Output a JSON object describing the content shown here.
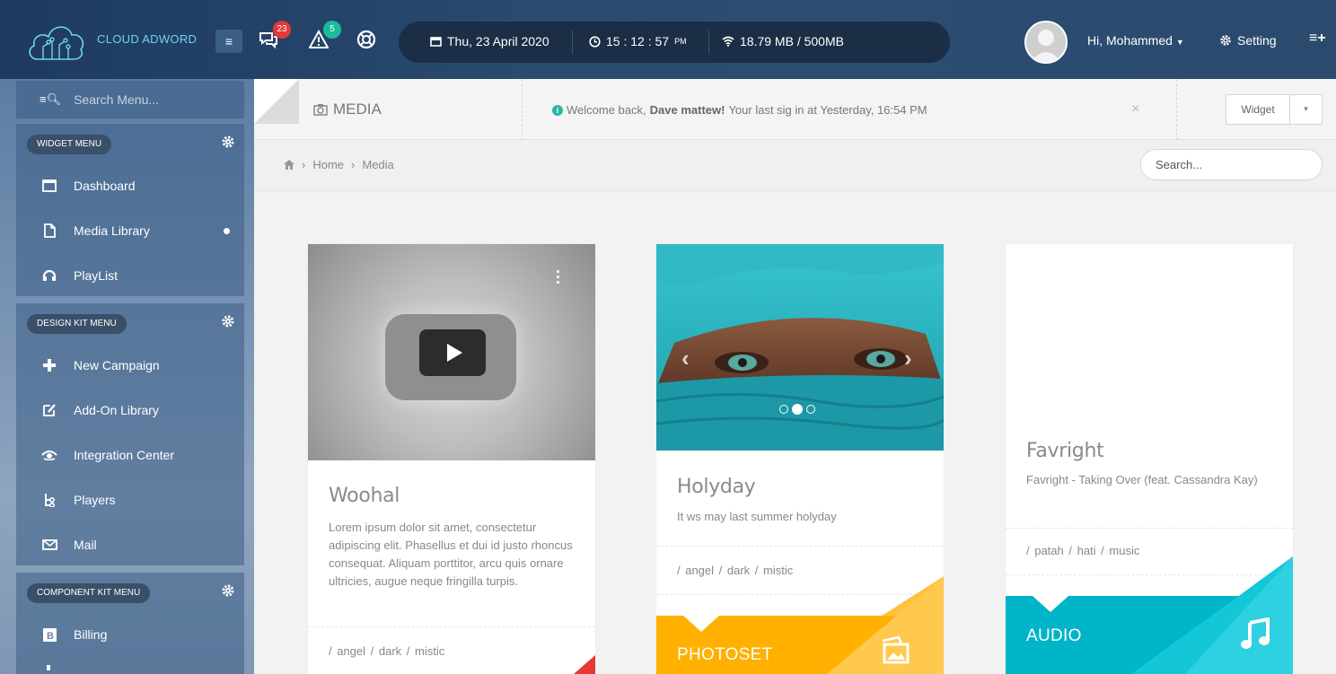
{
  "topbar": {
    "brand": "CLOUD ADWORD",
    "messages_badge": "23",
    "alerts_badge": "5",
    "date": "Thu, 23 April 2020",
    "time": "15 : 12 : 57",
    "time_suffix": "PM",
    "data_usage": "18.79 MB / 500MB",
    "greeting": "Hi, Mohammed",
    "setting_label": "Setting"
  },
  "sidebar": {
    "search_placeholder": "Search Menu...",
    "sections": [
      {
        "title": "WIDGET MENU",
        "items": [
          "Dashboard",
          "Media Library",
          "PlayList"
        ]
      },
      {
        "title": "DESIGN KIT MENU",
        "items": [
          "New Campaign",
          "Add-On Library",
          "Integration Center",
          "Players",
          "Mail"
        ]
      },
      {
        "title": "COMPONENT KIT MENU",
        "items": [
          "Billing"
        ]
      }
    ]
  },
  "header": {
    "page_title": "MEDIA",
    "welcome_prefix": "Welcome back,",
    "welcome_name": "Dave mattew!",
    "welcome_suffix": "Your last sig in at Yesterday, 16:54 PM",
    "widget_label": "Widget"
  },
  "breadcrumb": {
    "items": [
      "Home",
      "Media"
    ],
    "search_placeholder": "Search..."
  },
  "cards": [
    {
      "title": "Woohal",
      "desc": "Lorem ipsum dolor sit amet, consectetur adipiscing elit. Phasellus et dui id justo rhoncus consequat. Aliquam porttitor, arcu quis ornare ultricies, augue neque fringilla turpis.",
      "tags": "/ angel / dark / mistic"
    },
    {
      "title": "Holyday",
      "desc": "It ws may last summer holyday",
      "tags": "/ angel / dark / mistic",
      "band_label": "PHOTOSET"
    },
    {
      "title": "Favright",
      "desc": "Favright - Taking Over (feat. Cassandra Kay)",
      "tags": "/ patah / hati / music",
      "band_label": "AUDIO"
    }
  ],
  "colors": {
    "photoset_band": "#ffb300",
    "audio_band": "#00bcd4",
    "accent_red": "#e53935"
  }
}
